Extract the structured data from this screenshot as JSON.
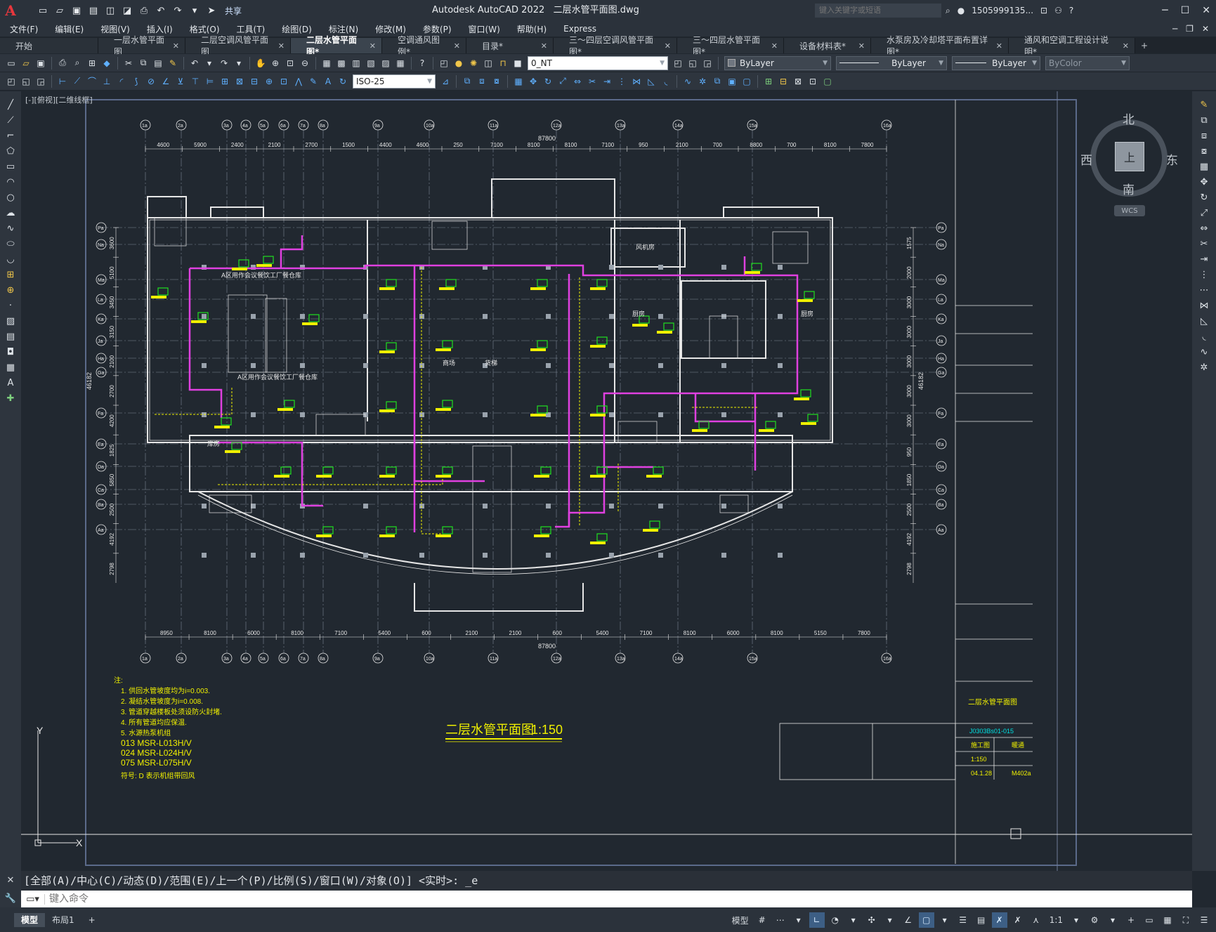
{
  "app": {
    "logo": "A",
    "title": "Autodesk AutoCAD 2022",
    "filename": "二层水管平面图.dwg",
    "share": "共享",
    "search_placeholder": "键入关键字或短语",
    "user": "1505999135...",
    "help": "?"
  },
  "menu": [
    "文件(F)",
    "编辑(E)",
    "视图(V)",
    "插入(I)",
    "格式(O)",
    "工具(T)",
    "绘图(D)",
    "标注(N)",
    "修改(M)",
    "参数(P)",
    "窗口(W)",
    "帮助(H)",
    "Express"
  ],
  "tabs": [
    {
      "label": "开始",
      "closable": false,
      "active": false
    },
    {
      "label": "一层水管平面图",
      "closable": true,
      "active": false
    },
    {
      "label": "二层空调风管平面图",
      "closable": true,
      "active": false
    },
    {
      "label": "二层水管平面图*",
      "closable": true,
      "active": true
    },
    {
      "label": "空调通风图例*",
      "closable": true,
      "active": false
    },
    {
      "label": "目录*",
      "closable": true,
      "active": false
    },
    {
      "label": "三～四层空调风管平面图*",
      "closable": true,
      "active": false
    },
    {
      "label": "三～四层水管平面图*",
      "closable": true,
      "active": false
    },
    {
      "label": "设备材料表*",
      "closable": true,
      "active": false
    },
    {
      "label": "水泵房及冷却塔平面布置详图*",
      "closable": true,
      "active": false
    },
    {
      "label": "通风和空调工程设计说明*",
      "closable": true,
      "active": false
    }
  ],
  "properties": {
    "layer": "0_NT",
    "color": "ByLayer",
    "linetype": "ByLayer",
    "lineweight": "ByLayer",
    "plotstyle": "ByColor",
    "dimstyle": "ISO-25"
  },
  "viewport": {
    "label": "[-][俯视][二维线框]",
    "north": "北",
    "south": "南",
    "east": "东",
    "west": "西",
    "face": "上",
    "wcs": "WCS"
  },
  "drawing": {
    "title": "二层水管平面图",
    "scale": "1:150",
    "notes_title": "注:",
    "notes": [
      "1. 供回水管坡度均为i=0.003.",
      "2. 凝结水管坡度为i=0.008.",
      "3. 管道穿越楼板处须设防火封堵.",
      "4. 所有管道均应保温.",
      "5. 水源热泵机组"
    ],
    "legend": [
      "013  MSR-L013H/V",
      "024  MSR-L024H/V",
      "075  MSR-L075H/V"
    ],
    "legend_note": "符号: D 表示机组带回风",
    "title_block": {
      "project": "J0303Bs01-015",
      "drawing_name": "二层水管平面图",
      "stage": "施工图",
      "discipline": "暖通",
      "scale": "1:150",
      "date": "04.1.28",
      "sheet": "M402a"
    },
    "dim_total": "87800",
    "dims_top": [
      "4600",
      "5900",
      "2400",
      "2100",
      "2700",
      "1500",
      "4400",
      "4600",
      "250",
      "7100",
      "8100",
      "8100",
      "7100",
      "950",
      "2100",
      "700",
      "8800",
      "700",
      "8100",
      "7800"
    ],
    "dims_bottom": [
      "8950",
      "8100",
      "6000",
      "8100",
      "7100",
      "5400",
      "600",
      "2100",
      "2100",
      "600",
      "5400",
      "7100",
      "8100",
      "6000",
      "8100",
      "5150",
      "7800"
    ],
    "dims_left": [
      "3600",
      "5100",
      "3450",
      "3150",
      "2100",
      "2700",
      "4200",
      "1825",
      "5850",
      "2500",
      "4192",
      "2798"
    ],
    "dims_right": [
      "1575",
      "2000",
      "3000",
      "3000",
      "3000",
      "3000",
      "3000",
      "950",
      "1850",
      "2500",
      "4192",
      "2798"
    ],
    "total_height": "46182",
    "col_labels": [
      "1a",
      "2a",
      "3a",
      "4a",
      "5a",
      "6a",
      "7a",
      "8a",
      "9a",
      "10a",
      "11a",
      "12a",
      "13a",
      "14a",
      "15a",
      "16a"
    ],
    "row_labels": [
      "Pa",
      "Na",
      "Ma",
      "La",
      "Ka",
      "Ja",
      "Ha",
      "Ga",
      "Fa",
      "Ea",
      "Da",
      "Ca",
      "Ba",
      "Aa"
    ],
    "room_labels": [
      "A区用作会议餐饮工厂餐仓库",
      "A区用作会议餐饮工厂餐仓库",
      "风机房",
      "厨房",
      "厨房",
      "库房",
      "商场",
      "货梯"
    ],
    "unit_label": "MSR-L024H"
  },
  "command": {
    "history": "[全部(A)/中心(C)/动态(D)/范围(E)/上一个(P)/比例(S)/窗口(W)/对象(O)] <实时>: _e",
    "placeholder": "键入命令"
  },
  "status": {
    "layouts": [
      "模型",
      "布局1"
    ],
    "model": "模型",
    "scale": "1:1"
  },
  "colors": {
    "background": "#212830",
    "hot_pipe": "#e040e0",
    "cold_pipe": "#f0f000",
    "unit": "#20e020",
    "wall": "#e6e6e6",
    "grid": "#9aa3ad",
    "accent": "#00e0e0"
  }
}
